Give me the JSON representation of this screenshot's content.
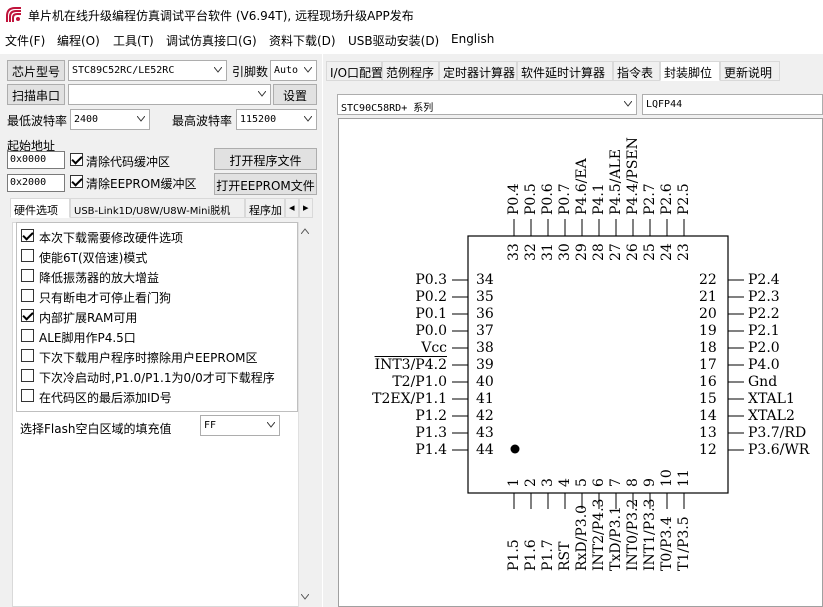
{
  "window": {
    "title": "单片机在线升级编程仿真调试平台软件 (V6.94T), 远程现场升级APP发布"
  },
  "menu": [
    "文件(F)",
    "编程(O)",
    "工具(T)",
    "调试仿真接口(G)",
    "资料下载(D)",
    "USB驱动安装(D)",
    "English"
  ],
  "left": {
    "chip_label": "芯片型号",
    "chip_value": "STC89C52RC/LE52RC",
    "pins_label": "引脚数",
    "pins_value": "Auto",
    "scan_button": "扫描串口",
    "port_value": "",
    "settings_button": "设置",
    "min_baud_label": "最低波特率",
    "min_baud_value": "2400",
    "max_baud_label": "最高波特率",
    "max_baud_value": "115200",
    "start_addr_label": "起始地址",
    "addr1": "0x0000",
    "clear_code_label": "清除代码缓冲区",
    "open_prog_button": "打开程序文件",
    "addr2": "0x2000",
    "clear_eeprom_label": "清除EEPROM缓冲区",
    "open_eeprom_button": "打开EEPROM文件",
    "tabs": [
      "硬件选项",
      "USB-Link1D/U8W/U8W-Mini脱机",
      "程序加"
    ],
    "options": [
      {
        "label": "本次下载需要修改硬件选项",
        "checked": true
      },
      {
        "label": "使能6T(双倍速)模式",
        "checked": false
      },
      {
        "label": "降低振荡器的放大增益",
        "checked": false
      },
      {
        "label": "只有断电才可停止看门狗",
        "checked": false
      },
      {
        "label": "内部扩展RAM可用",
        "checked": true
      },
      {
        "label": "ALE脚用作P4.5口",
        "checked": false
      },
      {
        "label": "下次下载用户程序时擦除用户EEPROM区",
        "checked": false
      },
      {
        "label": "下次冷启动时,P1.0/P1.1为0/0才可下载程序",
        "checked": false
      },
      {
        "label": "在代码区的最后添加ID号",
        "checked": false
      }
    ],
    "fill_label": "选择Flash空白区域的填充值",
    "fill_value": "FF"
  },
  "right": {
    "tabs": [
      "I/O口配置工具",
      "范例程序",
      "定时器计算器",
      "软件延时计算器",
      "指令表",
      "封装脚位",
      "更新说明"
    ],
    "selected_tab": "封装脚位",
    "series_value": "STC90C58RD+ 系列",
    "package_value": "LQFP44",
    "chip": {
      "top": [
        {
          "n": "33",
          "name": "P0.4"
        },
        {
          "n": "32",
          "name": "P0.5"
        },
        {
          "n": "31",
          "name": "P0.6"
        },
        {
          "n": "30",
          "name": "P0.7"
        },
        {
          "n": "29",
          "name": "P4.6/EA"
        },
        {
          "n": "28",
          "name": "P4.1"
        },
        {
          "n": "27",
          "name": "P4.5/ALE"
        },
        {
          "n": "26",
          "name": "P4.4/PSEN"
        },
        {
          "n": "25",
          "name": "P2.7"
        },
        {
          "n": "24",
          "name": "P2.6"
        },
        {
          "n": "23",
          "name": "P2.5"
        }
      ],
      "left": [
        {
          "n": "34",
          "name": "P0.3"
        },
        {
          "n": "35",
          "name": "P0.2"
        },
        {
          "n": "36",
          "name": "P0.1"
        },
        {
          "n": "37",
          "name": "P0.0"
        },
        {
          "n": "38",
          "name": "Vcc"
        },
        {
          "n": "39",
          "name": "INT3/P4.2"
        },
        {
          "n": "40",
          "name": "T2/P1.0"
        },
        {
          "n": "41",
          "name": "T2EX/P1.1"
        },
        {
          "n": "42",
          "name": "P1.2"
        },
        {
          "n": "43",
          "name": "P1.3"
        },
        {
          "n": "44",
          "name": "P1.4"
        }
      ],
      "right": [
        {
          "n": "22",
          "name": "P2.4"
        },
        {
          "n": "21",
          "name": "P2.3"
        },
        {
          "n": "20",
          "name": "P2.2"
        },
        {
          "n": "19",
          "name": "P2.1"
        },
        {
          "n": "18",
          "name": "P2.0"
        },
        {
          "n": "17",
          "name": "P4.0"
        },
        {
          "n": "16",
          "name": "Gnd"
        },
        {
          "n": "15",
          "name": "XTAL1"
        },
        {
          "n": "14",
          "name": "XTAL2"
        },
        {
          "n": "13",
          "name": "P3.7/RD"
        },
        {
          "n": "12",
          "name": "P3.6/WR"
        }
      ],
      "bottom": [
        {
          "n": "1",
          "name": "P1.5"
        },
        {
          "n": "2",
          "name": "P1.6"
        },
        {
          "n": "3",
          "name": "P1.7"
        },
        {
          "n": "4",
          "name": "RST"
        },
        {
          "n": "5",
          "name": "RxD/P3.0"
        },
        {
          "n": "6",
          "name": "INT2/P4.3"
        },
        {
          "n": "7",
          "name": "TxD/P3.1"
        },
        {
          "n": "8",
          "name": "INT0/P3.2"
        },
        {
          "n": "9",
          "name": "INT1/P3.3"
        },
        {
          "n": "10",
          "name": "T0/P3.4"
        },
        {
          "n": "11",
          "name": "T1/P3.5"
        }
      ]
    }
  }
}
